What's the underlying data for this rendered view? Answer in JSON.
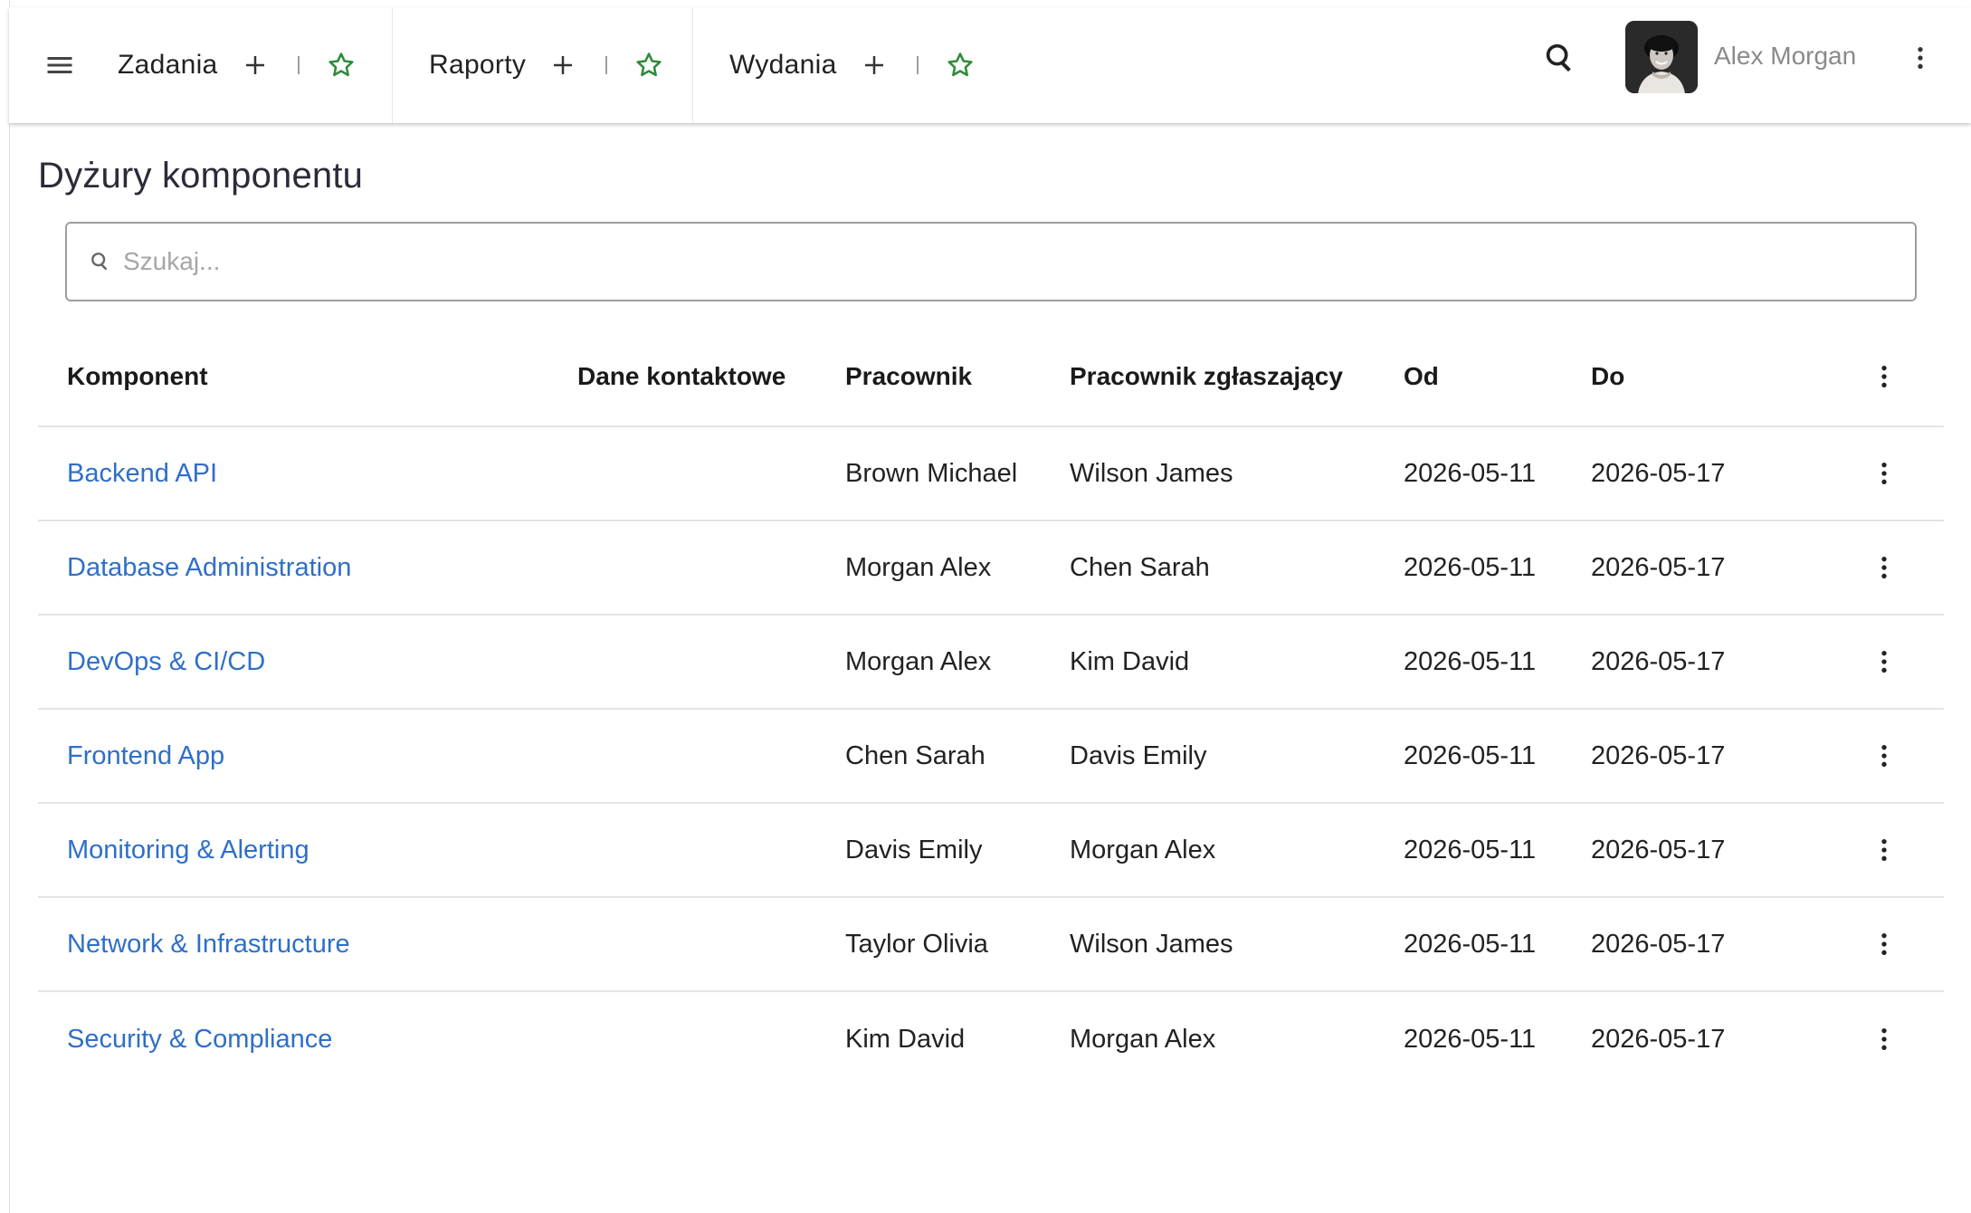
{
  "topbar": {
    "tabs": [
      {
        "label": "Zadania"
      },
      {
        "label": "Raporty"
      },
      {
        "label": "Wydania"
      }
    ],
    "user_name": "Alex Morgan",
    "icons": {
      "menu": "menu-icon",
      "add": "plus-icon",
      "favorite": "star-outline-icon",
      "search": "search-icon",
      "more": "more-vert-icon"
    },
    "colors": {
      "star": "#2e8b3a"
    }
  },
  "page": {
    "title": "Dyżury komponentu"
  },
  "search": {
    "placeholder": "Szukaj...",
    "value": ""
  },
  "table": {
    "columns": {
      "component": "Komponent",
      "contact": "Dane kontaktowe",
      "employee": "Pracownik",
      "reporter": "Pracownik zgłaszający",
      "from": "Od",
      "to": "Do"
    },
    "rows": [
      {
        "component": "Backend API",
        "contact": "",
        "employee": "Brown Michael",
        "reporter": "Wilson James",
        "from": "2026-05-11",
        "to": "2026-05-17"
      },
      {
        "component": "Database Administration",
        "contact": "",
        "employee": "Morgan Alex",
        "reporter": "Chen Sarah",
        "from": "2026-05-11",
        "to": "2026-05-17"
      },
      {
        "component": "DevOps & CI/CD",
        "contact": "",
        "employee": "Morgan Alex",
        "reporter": "Kim David",
        "from": "2026-05-11",
        "to": "2026-05-17"
      },
      {
        "component": "Frontend App",
        "contact": "",
        "employee": "Chen Sarah",
        "reporter": "Davis Emily",
        "from": "2026-05-11",
        "to": "2026-05-17"
      },
      {
        "component": "Monitoring & Alerting",
        "contact": "",
        "employee": "Davis Emily",
        "reporter": "Morgan Alex",
        "from": "2026-05-11",
        "to": "2026-05-17"
      },
      {
        "component": "Network & Infrastructure",
        "contact": "",
        "employee": "Taylor Olivia",
        "reporter": "Wilson James",
        "from": "2026-05-11",
        "to": "2026-05-17"
      },
      {
        "component": "Security & Compliance",
        "contact": "",
        "employee": "Kim David",
        "reporter": "Morgan Alex",
        "from": "2026-05-11",
        "to": "2026-05-17"
      }
    ],
    "link_color": "#2f6fc7"
  }
}
